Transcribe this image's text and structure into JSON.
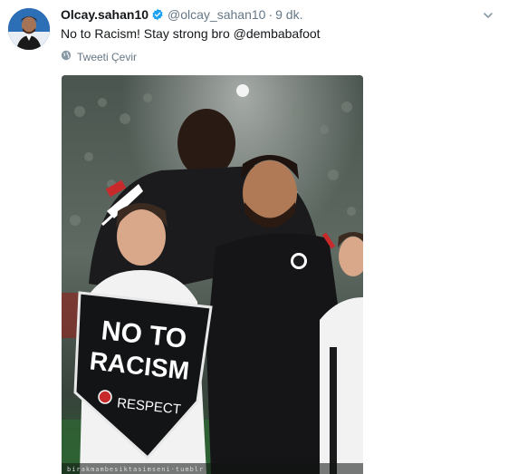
{
  "tweet": {
    "display_name": "Olcay.sahan10",
    "handle": "@olcay_sahan10",
    "separator": "·",
    "time": "9 dk.",
    "text": "No to Racism! Stay strong bro @dembabafoot",
    "translate_label": "Tweeti Çevir"
  },
  "photo": {
    "banner_line1": "NO TO",
    "banner_line2": "RACISM",
    "banner_badge": "RESPECT",
    "watermark": "birakmambesiktasimseni·tumblr"
  },
  "colors": {
    "verified": "#1da1f2",
    "secondary_text": "#657786",
    "primary_text": "#14171a"
  },
  "icons": {
    "verified": "verified-badge-icon",
    "caret": "chevron-down-icon",
    "translate": "globe-icon"
  }
}
